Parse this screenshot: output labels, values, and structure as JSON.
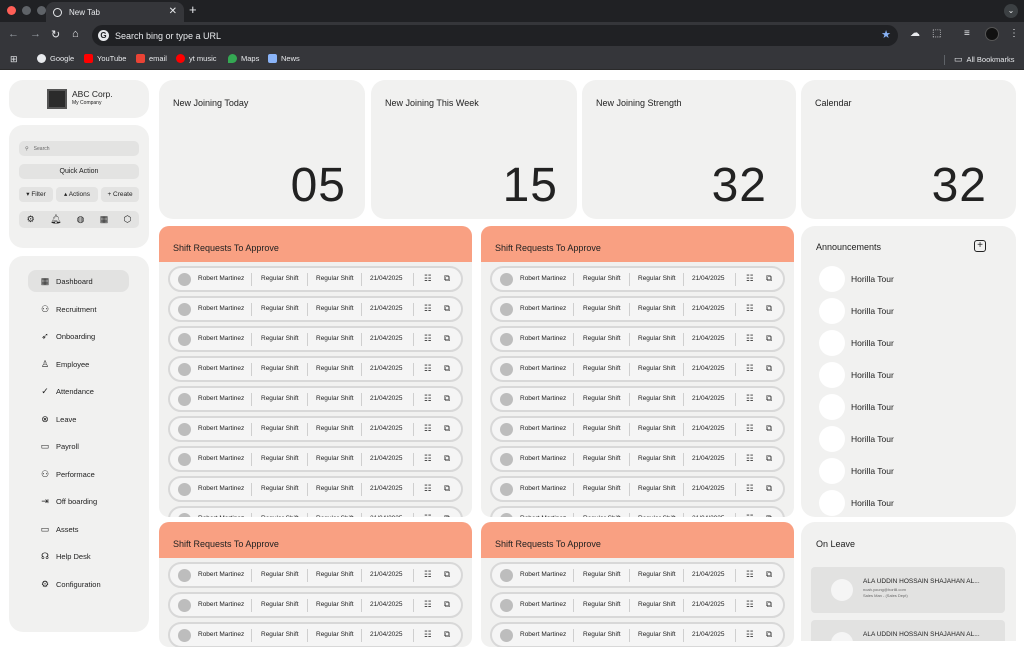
{
  "browser": {
    "tab_title": "New Tab",
    "omnibox_placeholder": "Search bing or type a URL",
    "bookmarks": [
      "Google",
      "YouTube",
      "email",
      "yt music",
      "Maps",
      "News"
    ],
    "all_bookmarks": "All Bookmarks"
  },
  "company": {
    "name": "ABC Corp.",
    "sub": "My Company"
  },
  "sidebar": {
    "search_placeholder": "Search",
    "quick_action": "Quick Action",
    "filter": "Filter",
    "actions": "Actions",
    "create": "Create",
    "nav": [
      {
        "label": "Dashboard",
        "icon": "grid-icon"
      },
      {
        "label": "Recruitment",
        "icon": "people-icon"
      },
      {
        "label": "Onboarding",
        "icon": "rocket-icon"
      },
      {
        "label": "Employee",
        "icon": "user-icon"
      },
      {
        "label": "Attendance",
        "icon": "check-icon"
      },
      {
        "label": "Leave",
        "icon": "x-circle-icon"
      },
      {
        "label": "Payroll",
        "icon": "wallet-icon"
      },
      {
        "label": "Performace",
        "icon": "people-icon"
      },
      {
        "label": "Off boarding",
        "icon": "exit-icon"
      },
      {
        "label": "Assets",
        "icon": "laptop-icon"
      },
      {
        "label": "Help Desk",
        "icon": "headset-icon"
      },
      {
        "label": "Configuration",
        "icon": "gear-icon"
      }
    ]
  },
  "stats": [
    {
      "label": "New Joining Today",
      "value": "05"
    },
    {
      "label": "New Joining This Week",
      "value": "15"
    },
    {
      "label": "New Joining Strength",
      "value": "32"
    },
    {
      "label": "Calendar",
      "value": "32"
    }
  ],
  "shift_panel_title": "Shift Requests To Approve",
  "shift_row": {
    "name": "Robert Martinez",
    "from": "Regular Shift",
    "to": "Regular Shift",
    "date": "21/04/2025"
  },
  "announcements": {
    "title": "Announcements",
    "items": [
      "Horilla Tour",
      "Horilla Tour",
      "Horilla Tour",
      "Horilla Tour",
      "Horilla Tour",
      "Horilla Tour",
      "Horilla Tour",
      "Horilla Tour"
    ]
  },
  "on_leave": {
    "title": "On Leave",
    "items": [
      {
        "name": "ALA UDDIN HOSSAIN SHAJAHAN AL...",
        "email": "noah.young@horilll.com",
        "dept": "Sales Man - (Sales Dept)"
      },
      {
        "name": "ALA UDDIN HOSSAIN SHAJAHAN AL...",
        "email": "",
        "dept": ""
      }
    ]
  }
}
